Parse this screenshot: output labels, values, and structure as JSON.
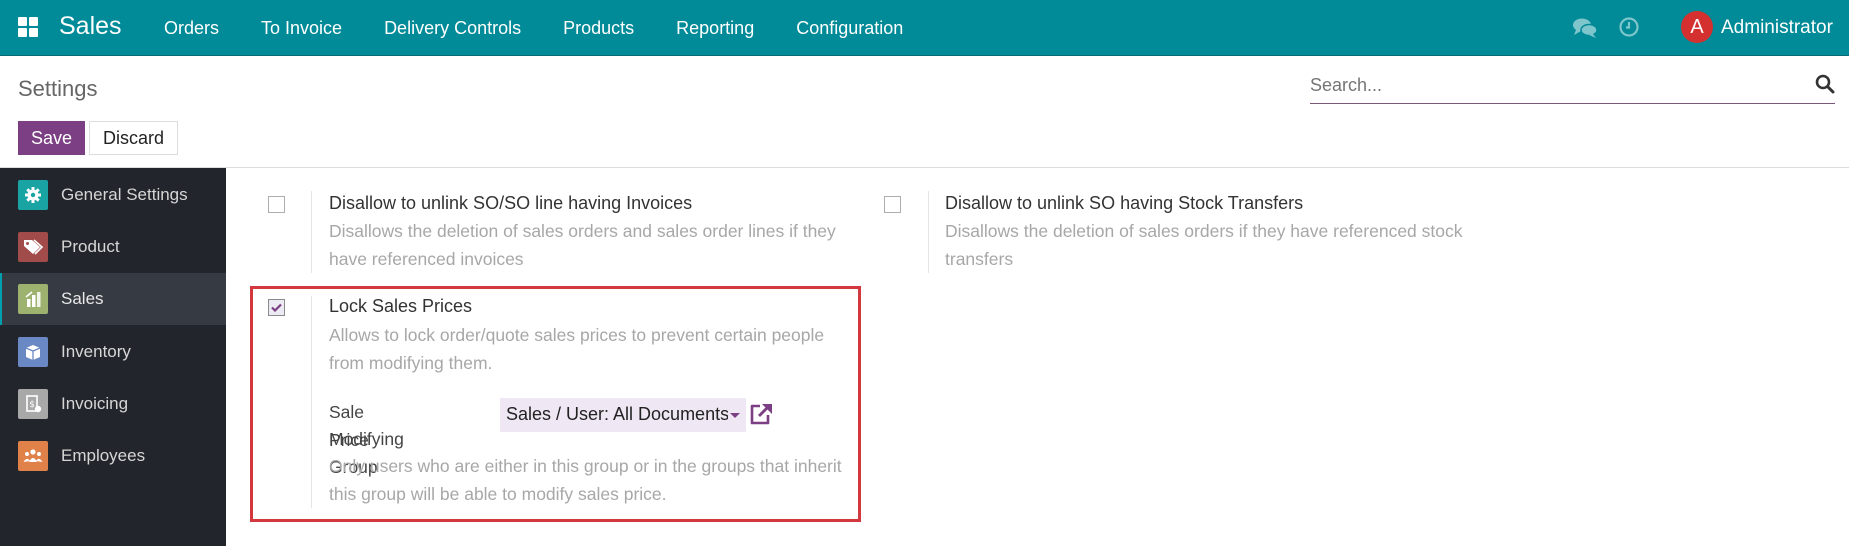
{
  "navbar": {
    "brand": "Sales",
    "menu": [
      "Orders",
      "To Invoice",
      "Delivery Controls",
      "Products",
      "Reporting",
      "Configuration"
    ],
    "icons": {
      "apps": "apps-grid-icon",
      "chat": "chat-icon",
      "activity": "clock-icon"
    },
    "user": {
      "initial": "A",
      "name": "Administrator",
      "avatar_color": "#d3302f"
    },
    "color": "#018a97"
  },
  "control_panel": {
    "title": "Settings",
    "search_placeholder": "Search...",
    "save_label": "Save",
    "discard_label": "Discard",
    "save_color": "#7c3f84"
  },
  "sidebar": {
    "items": [
      {
        "label": "General Settings",
        "icon": "gear-icon",
        "color": "#1aa3a3",
        "active": false
      },
      {
        "label": "Product",
        "icon": "tag-icon",
        "color": "#a14b4b",
        "active": false
      },
      {
        "label": "Sales",
        "icon": "chart-icon",
        "color": "#9eb270",
        "active": true
      },
      {
        "label": "Inventory",
        "icon": "box-icon",
        "color": "#6a89c4",
        "active": false
      },
      {
        "label": "Invoicing",
        "icon": "invoice-icon",
        "color": "#a8a8a8",
        "active": false
      },
      {
        "label": "Employees",
        "icon": "people-icon",
        "color": "#e0814a",
        "active": false
      }
    ]
  },
  "settings": {
    "unlink_invoices": {
      "title": "Disallow to unlink SO/SO line having Invoices",
      "description": "Disallows the deletion of sales orders and sales order lines if they have referenced invoices",
      "checked": false
    },
    "unlink_transfers": {
      "title": "Disallow to unlink SO having Stock Transfers",
      "description": "Disallows the deletion of sales orders if they have referenced stock transfers",
      "checked": false
    },
    "lock_prices": {
      "title": "Lock Sales Prices",
      "description": "Allows to lock order/quote sales prices to prevent certain people from modifying them.",
      "checked": true,
      "field_label_line1": "Sale Price",
      "field_label_line2": "Modifying Group",
      "field_value": "Sales / User: All Documents",
      "field_help": "Only users who are either in this group or in the groups that inherit this group will be able to modify sales price.",
      "highlight_color": "#d2383e"
    }
  }
}
